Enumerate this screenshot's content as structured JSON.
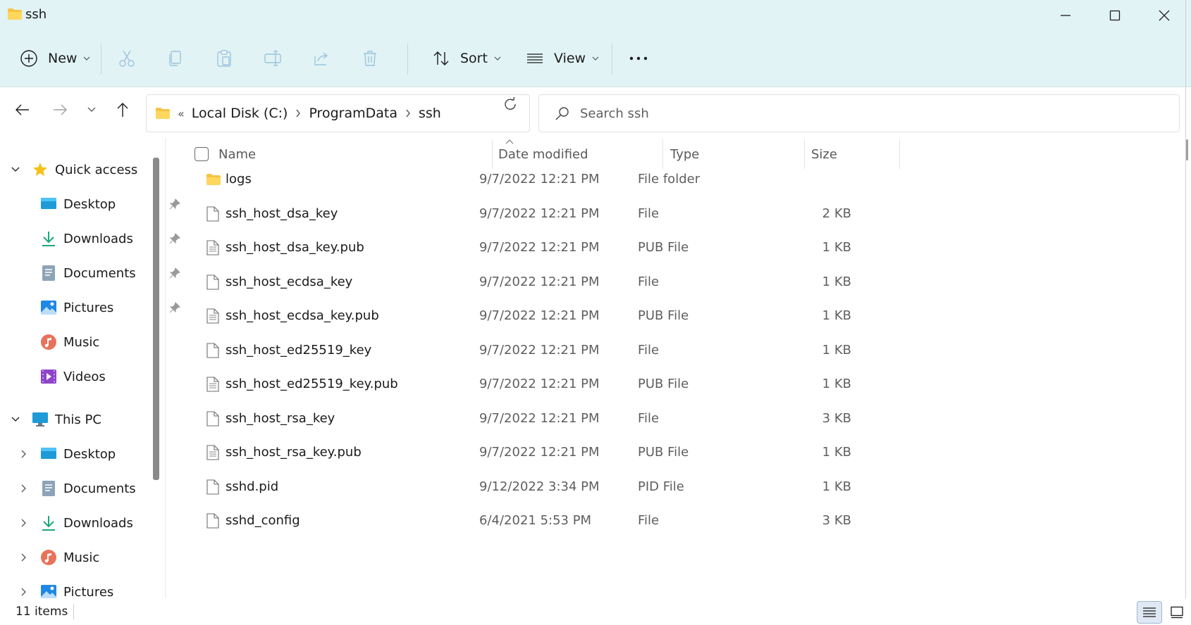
{
  "window": {
    "title": "ssh"
  },
  "toolbar": {
    "new_label": "New",
    "sort_label": "Sort",
    "view_label": "View"
  },
  "address": {
    "overflow": "«",
    "crumbs": [
      "Local Disk (C:)",
      "ProgramData",
      "ssh"
    ]
  },
  "search": {
    "placeholder": "Search ssh"
  },
  "sidebar": {
    "quick_access": {
      "label": "Quick access"
    },
    "quick_items": [
      {
        "label": "Desktop",
        "icon": "desktop-icon",
        "pinned": true
      },
      {
        "label": "Downloads",
        "icon": "downloads-icon",
        "pinned": true
      },
      {
        "label": "Documents",
        "icon": "documents-icon",
        "pinned": true
      },
      {
        "label": "Pictures",
        "icon": "pictures-icon",
        "pinned": true
      },
      {
        "label": "Music",
        "icon": "music-icon",
        "pinned": false
      },
      {
        "label": "Videos",
        "icon": "videos-icon",
        "pinned": false
      }
    ],
    "this_pc": {
      "label": "This PC"
    },
    "pc_items": [
      {
        "label": "Desktop",
        "icon": "desktop-icon"
      },
      {
        "label": "Documents",
        "icon": "documents-icon"
      },
      {
        "label": "Downloads",
        "icon": "downloads-icon"
      },
      {
        "label": "Music",
        "icon": "music-icon"
      },
      {
        "label": "Pictures",
        "icon": "pictures-icon"
      }
    ]
  },
  "columns": {
    "name": "Name",
    "date": "Date modified",
    "type": "Type",
    "size": "Size"
  },
  "files": [
    {
      "name": "logs",
      "date": "9/7/2022 12:21 PM",
      "type": "File folder",
      "size": "",
      "icon": "folder-icon"
    },
    {
      "name": "ssh_host_dsa_key",
      "date": "9/7/2022 12:21 PM",
      "type": "File",
      "size": "2 KB",
      "icon": "file-icon"
    },
    {
      "name": "ssh_host_dsa_key.pub",
      "date": "9/7/2022 12:21 PM",
      "type": "PUB File",
      "size": "1 KB",
      "icon": "text-file-icon"
    },
    {
      "name": "ssh_host_ecdsa_key",
      "date": "9/7/2022 12:21 PM",
      "type": "File",
      "size": "1 KB",
      "icon": "file-icon"
    },
    {
      "name": "ssh_host_ecdsa_key.pub",
      "date": "9/7/2022 12:21 PM",
      "type": "PUB File",
      "size": "1 KB",
      "icon": "text-file-icon"
    },
    {
      "name": "ssh_host_ed25519_key",
      "date": "9/7/2022 12:21 PM",
      "type": "File",
      "size": "1 KB",
      "icon": "file-icon"
    },
    {
      "name": "ssh_host_ed25519_key.pub",
      "date": "9/7/2022 12:21 PM",
      "type": "PUB File",
      "size": "1 KB",
      "icon": "text-file-icon"
    },
    {
      "name": "ssh_host_rsa_key",
      "date": "9/7/2022 12:21 PM",
      "type": "File",
      "size": "3 KB",
      "icon": "file-icon"
    },
    {
      "name": "ssh_host_rsa_key.pub",
      "date": "9/7/2022 12:21 PM",
      "type": "PUB File",
      "size": "1 KB",
      "icon": "text-file-icon"
    },
    {
      "name": "sshd.pid",
      "date": "9/12/2022 3:34 PM",
      "type": "PID File",
      "size": "1 KB",
      "icon": "file-icon"
    },
    {
      "name": "sshd_config",
      "date": "6/4/2021 5:53 PM",
      "type": "File",
      "size": "3 KB",
      "icon": "file-icon"
    }
  ],
  "status": {
    "item_count": "11 items"
  },
  "colors": {
    "mica": "#e1f3f5",
    "folder": "#f6c443",
    "accent": "#0a64c8"
  }
}
